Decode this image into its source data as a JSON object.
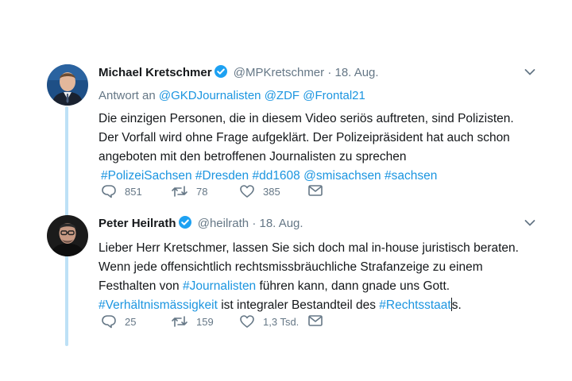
{
  "tweets": [
    {
      "name": "Michael Kretschmer",
      "handle": "@MPKretschmer",
      "dot": "·",
      "date": "18. Aug.",
      "reply_prefix": "Antwort an",
      "reply_to": [
        "@GKDJournalisten",
        "@ZDF",
        "@Frontal21"
      ],
      "lines": [
        "Die einzigen Personen, die in diesem Video seriös auftreten, sind Polizisten.",
        "Der Vorfall wird ohne Frage aufgeklärt. Der Polizeipräsident hat auch schon",
        "angeboten mit den betroffenen Journalisten zu sprechen"
      ],
      "hashtags": [
        "#PolizeiSachsen",
        "#Dresden",
        "#dd1608",
        "@smisachsen",
        "#sachsen"
      ],
      "replies": "851",
      "retweets": "78",
      "likes": "385"
    },
    {
      "name": "Peter Heilrath",
      "handle": "@heilrath",
      "dot": "·",
      "date": "18. Aug.",
      "line1": "Lieber Herr Kretschmer, lassen Sie sich doch mal in-house juristisch beraten.",
      "line2": "Wenn jede offensichtlich rechtsmissbräuchliche Strafanzeige zu einem",
      "line3_a": "Festhalten von ",
      "line3_link": "#Journalisten",
      "line3_b": " führen kann, dann gnade uns Gott.",
      "line4_link1": "#Verhältnismässigkeit",
      "line4_a": " ist integraler Bestandteil des ",
      "line4_link2": "#Rechtsstaat",
      "line4_b": "s.",
      "replies": "25",
      "retweets": "159",
      "likes": "1,3 Tsd."
    }
  ],
  "icons": {
    "verified": "verified-badge-icon",
    "caret": "chevron-down-icon",
    "reply": "reply-icon",
    "retweet": "retweet-icon",
    "like": "heart-icon",
    "dm": "envelope-icon"
  },
  "colors": {
    "link": "#1b95e0",
    "muted": "#657786",
    "thread": "#bde1f6",
    "text": "#14171a"
  }
}
